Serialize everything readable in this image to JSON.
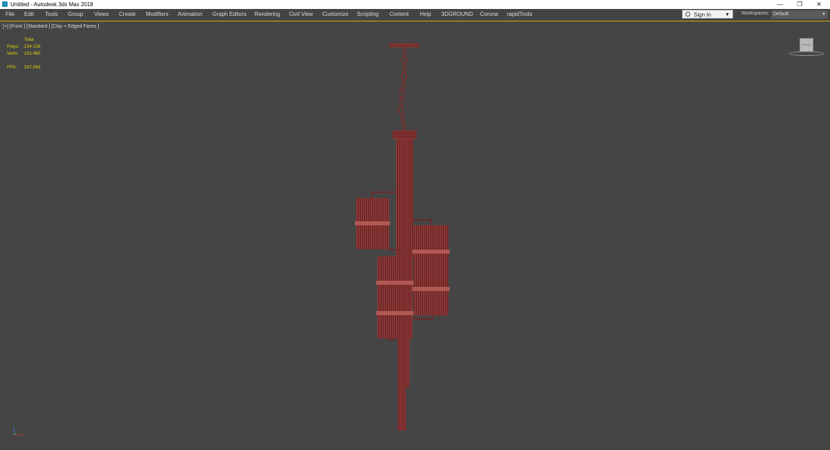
{
  "window": {
    "title": "Untitled - Autodesk 3ds Max 2018",
    "minimize_glyph": "—",
    "restore_glyph": "❐",
    "close_glyph": "✕"
  },
  "menu": [
    {
      "label": "File"
    },
    {
      "label": "Edit"
    },
    {
      "label": "Tools"
    },
    {
      "label": "Group"
    },
    {
      "label": "Views"
    },
    {
      "label": "Create"
    },
    {
      "label": "Modifiers"
    },
    {
      "label": "Animation"
    },
    {
      "label": "Graph Editors"
    },
    {
      "label": "Rendering"
    },
    {
      "label": "Civil View"
    },
    {
      "label": "Customize"
    },
    {
      "label": "Scripting"
    },
    {
      "label": "Content"
    },
    {
      "label": "Help"
    },
    {
      "label": "3DGROUND"
    },
    {
      "label": "Corona"
    },
    {
      "label": "rapidTools"
    }
  ],
  "account": {
    "sign_in_label": "Sign In",
    "caret": "▼"
  },
  "workspaces": {
    "label": "Workspaces:",
    "value": "Default",
    "caret": "▼"
  },
  "viewport": {
    "label": "[+] [Front ] [Standard ] [Clay + Edged Faces ]",
    "stats": {
      "total_label": "Total",
      "polys_label": "Polys:",
      "polys_value": "234 216",
      "verts_label": "Verts:",
      "verts_value": "131 460",
      "fps_label": "FPS:",
      "fps_value": "307,569"
    },
    "viewcube_label": "FRONT"
  },
  "colors": {
    "background": "#454545",
    "wireframe": "#7a2c2c",
    "wire_light": "#a64a46",
    "stats_text": "#e6d800",
    "viewport_border": "#d8b200"
  }
}
